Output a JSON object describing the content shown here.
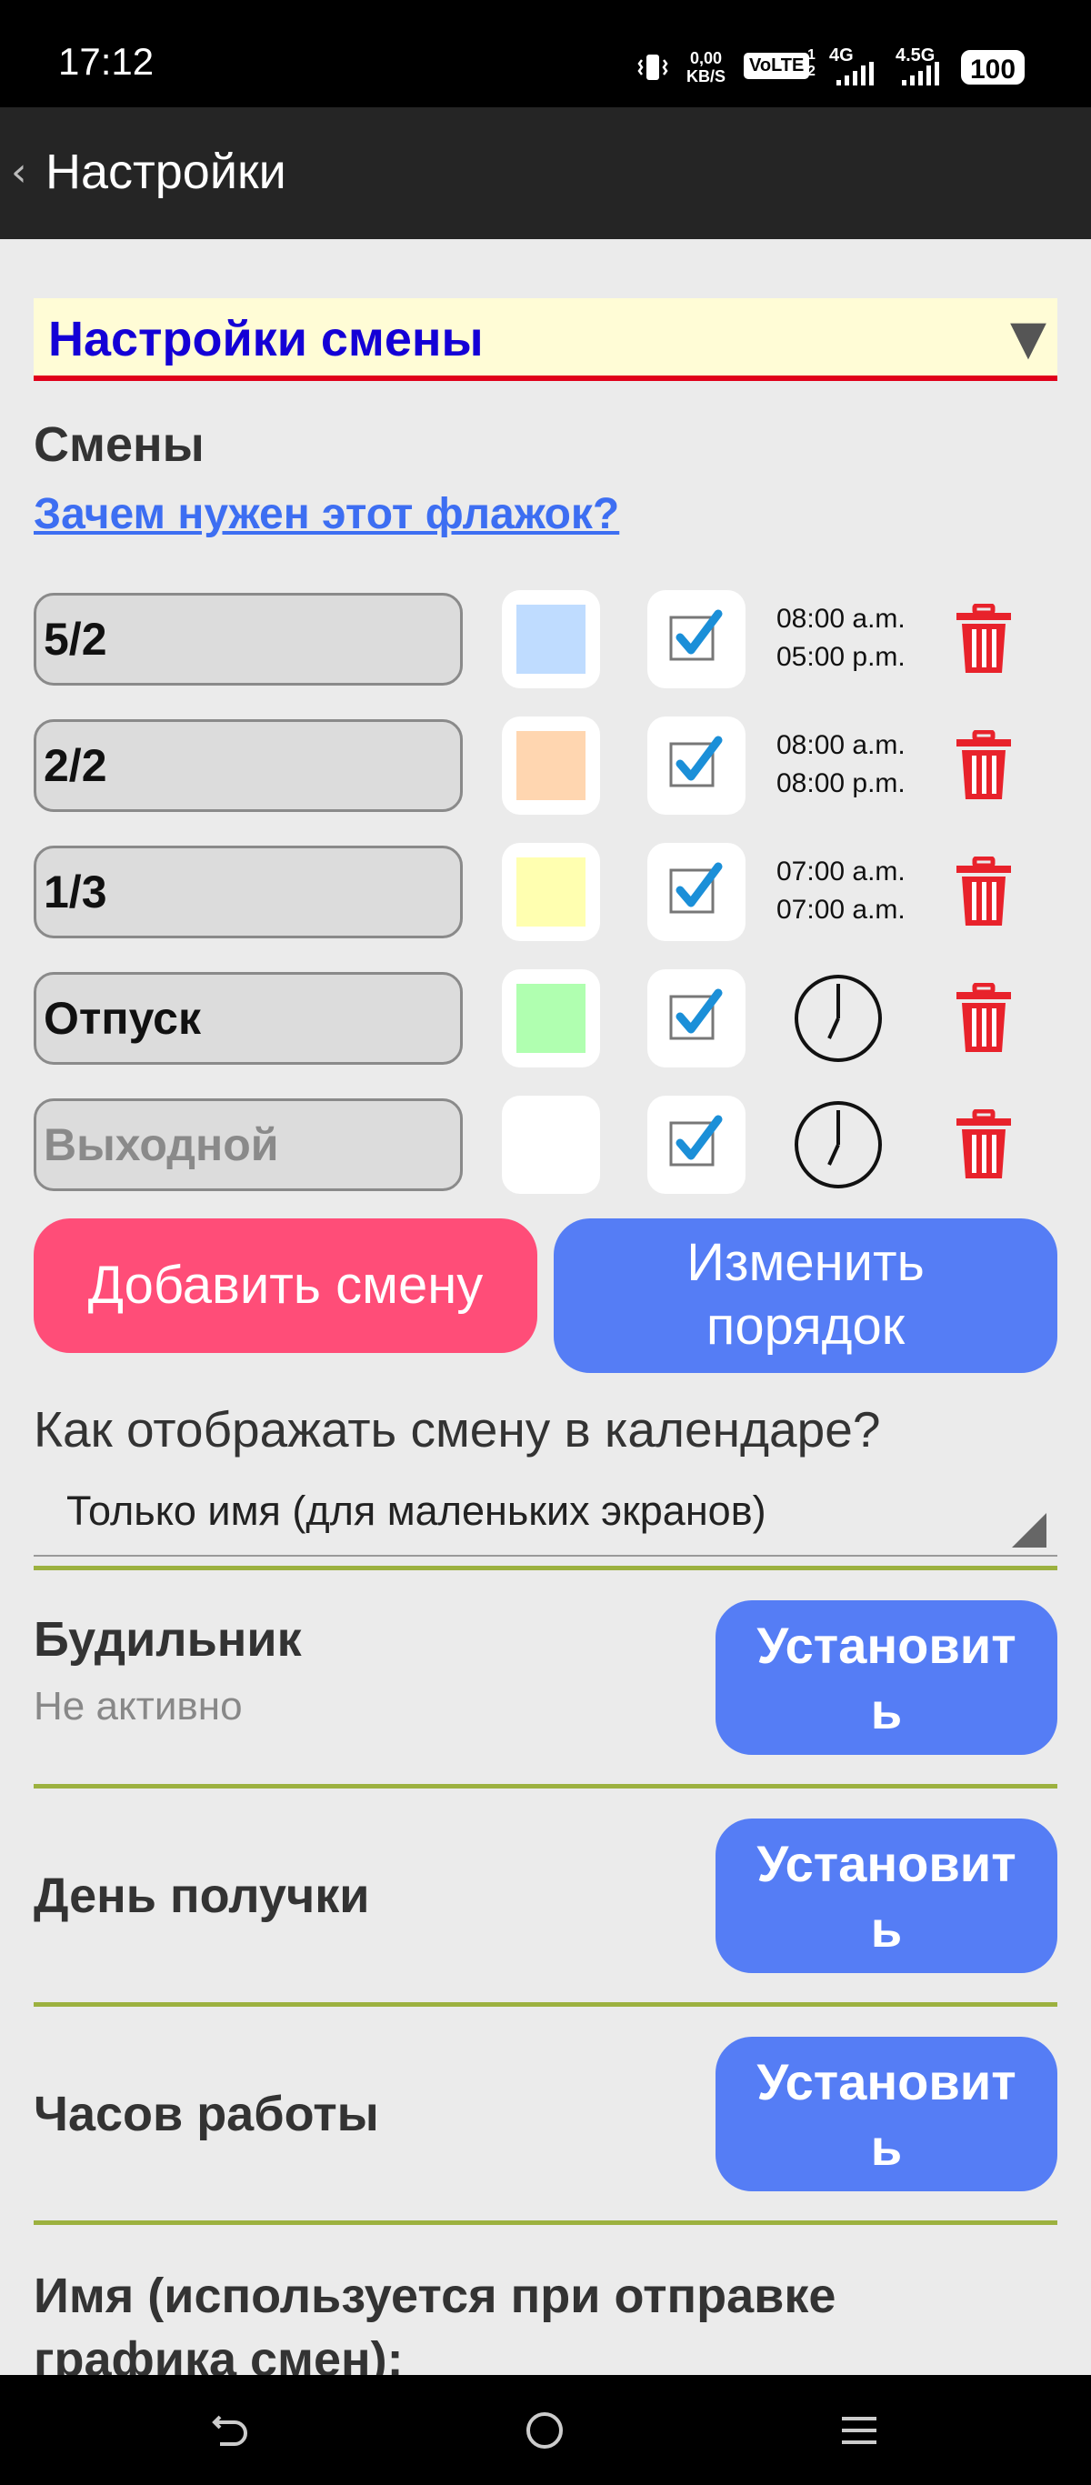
{
  "status_bar": {
    "time": "17:12",
    "net_speed_value": "0,00",
    "net_speed_unit": "KB/S",
    "volte": "VoLTE",
    "sim1": "1",
    "sim2": "2",
    "net1": "4G",
    "net2": "4.5G",
    "battery": "100"
  },
  "app_bar": {
    "back_glyph": "‹",
    "title": "Настройки"
  },
  "section_select": {
    "value": "Настройки смены",
    "arrow_glyph": "▼"
  },
  "shifts": {
    "heading": "Смены",
    "help_link": "Зачем нужен этот флажок?",
    "rows": [
      {
        "name": "5/2",
        "color": "#bfdcff",
        "checked": true,
        "start": "08:00 a.m.",
        "end": "05:00 p.m."
      },
      {
        "name": "2/2",
        "color": "#ffd6b0",
        "checked": true,
        "start": "08:00 a.m.",
        "end": "08:00 p.m."
      },
      {
        "name": "1/3",
        "color": "#ffffb0",
        "checked": true,
        "start": "07:00 a.m.",
        "end": "07:00 a.m."
      },
      {
        "name": "Отпуск",
        "color": "#b0ffb0",
        "checked": true,
        "start": "",
        "end": ""
      },
      {
        "name": "",
        "placeholder": "Выходной",
        "color": "#ffffff",
        "checked": true,
        "start": "",
        "end": ""
      }
    ],
    "add_button": "Добавить смену",
    "reorder_button_line1": "Изменить",
    "reorder_button_line2": "порядок"
  },
  "display": {
    "question": "Как отображать смену в календаре?",
    "selected": "Только имя (для маленьких экранов)"
  },
  "alarm": {
    "title": "Будильник",
    "status": "Не активно",
    "button_line1": "Установит",
    "button_line2": "ь"
  },
  "payday": {
    "title": "День получки",
    "button_line1": "Установит",
    "button_line2": "ь"
  },
  "work_hours": {
    "title": "Часов работы",
    "button_line1": "Установит",
    "button_line2": "ь"
  },
  "name_section": {
    "title_line1": "Имя (используется при отправке",
    "title_line2": "графика смен):"
  },
  "colors": {
    "accent_blue": "#557df5",
    "accent_pink": "#ff4d78",
    "divider": "#9cb13f",
    "delete_red": "#e8222b",
    "check_blue": "#1b8fd8"
  }
}
